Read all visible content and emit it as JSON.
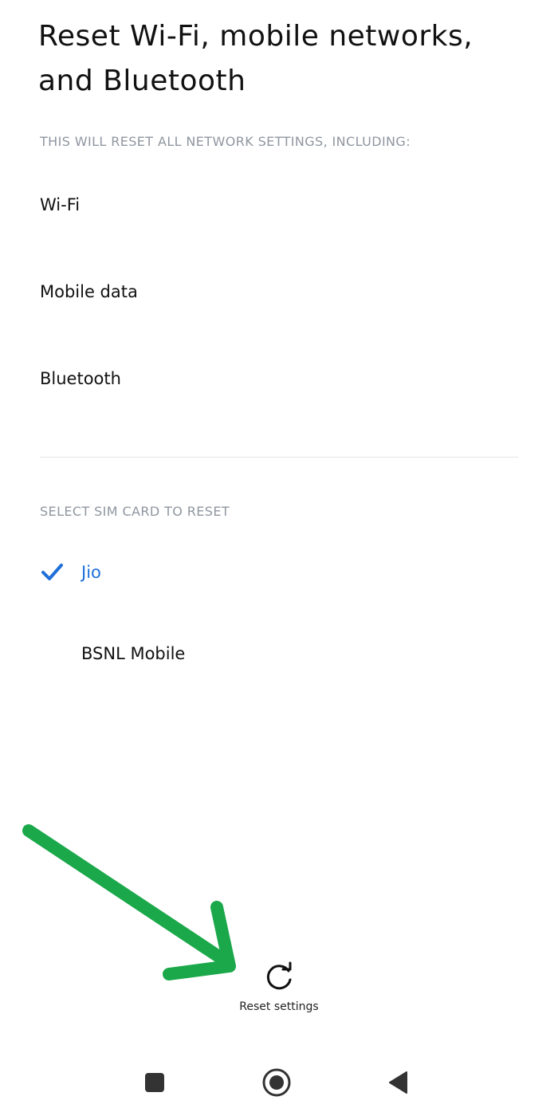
{
  "header": {
    "title": "Reset Wi-Fi, mobile networks, and Bluetooth"
  },
  "network_section": {
    "header": "THIS WILL RESET ALL NETWORK SETTINGS, INCLUDING:",
    "items": [
      {
        "label": "Wi-Fi"
      },
      {
        "label": "Mobile data"
      },
      {
        "label": "Bluetooth"
      }
    ]
  },
  "sim_section": {
    "header": "SELECT SIM CARD TO RESET",
    "options": [
      {
        "label": "Jio",
        "selected": true
      },
      {
        "label": "BSNL Mobile",
        "selected": false
      }
    ]
  },
  "reset_button": {
    "label": "Reset settings",
    "icon": "refresh-icon"
  },
  "navbar": {
    "icons": [
      "recents-square-icon",
      "home-circle-icon",
      "back-triangle-icon"
    ]
  },
  "colors": {
    "accent": "#1e6fd9",
    "annotation_arrow": "#1aa84a",
    "section_header": "#8f96a0"
  }
}
